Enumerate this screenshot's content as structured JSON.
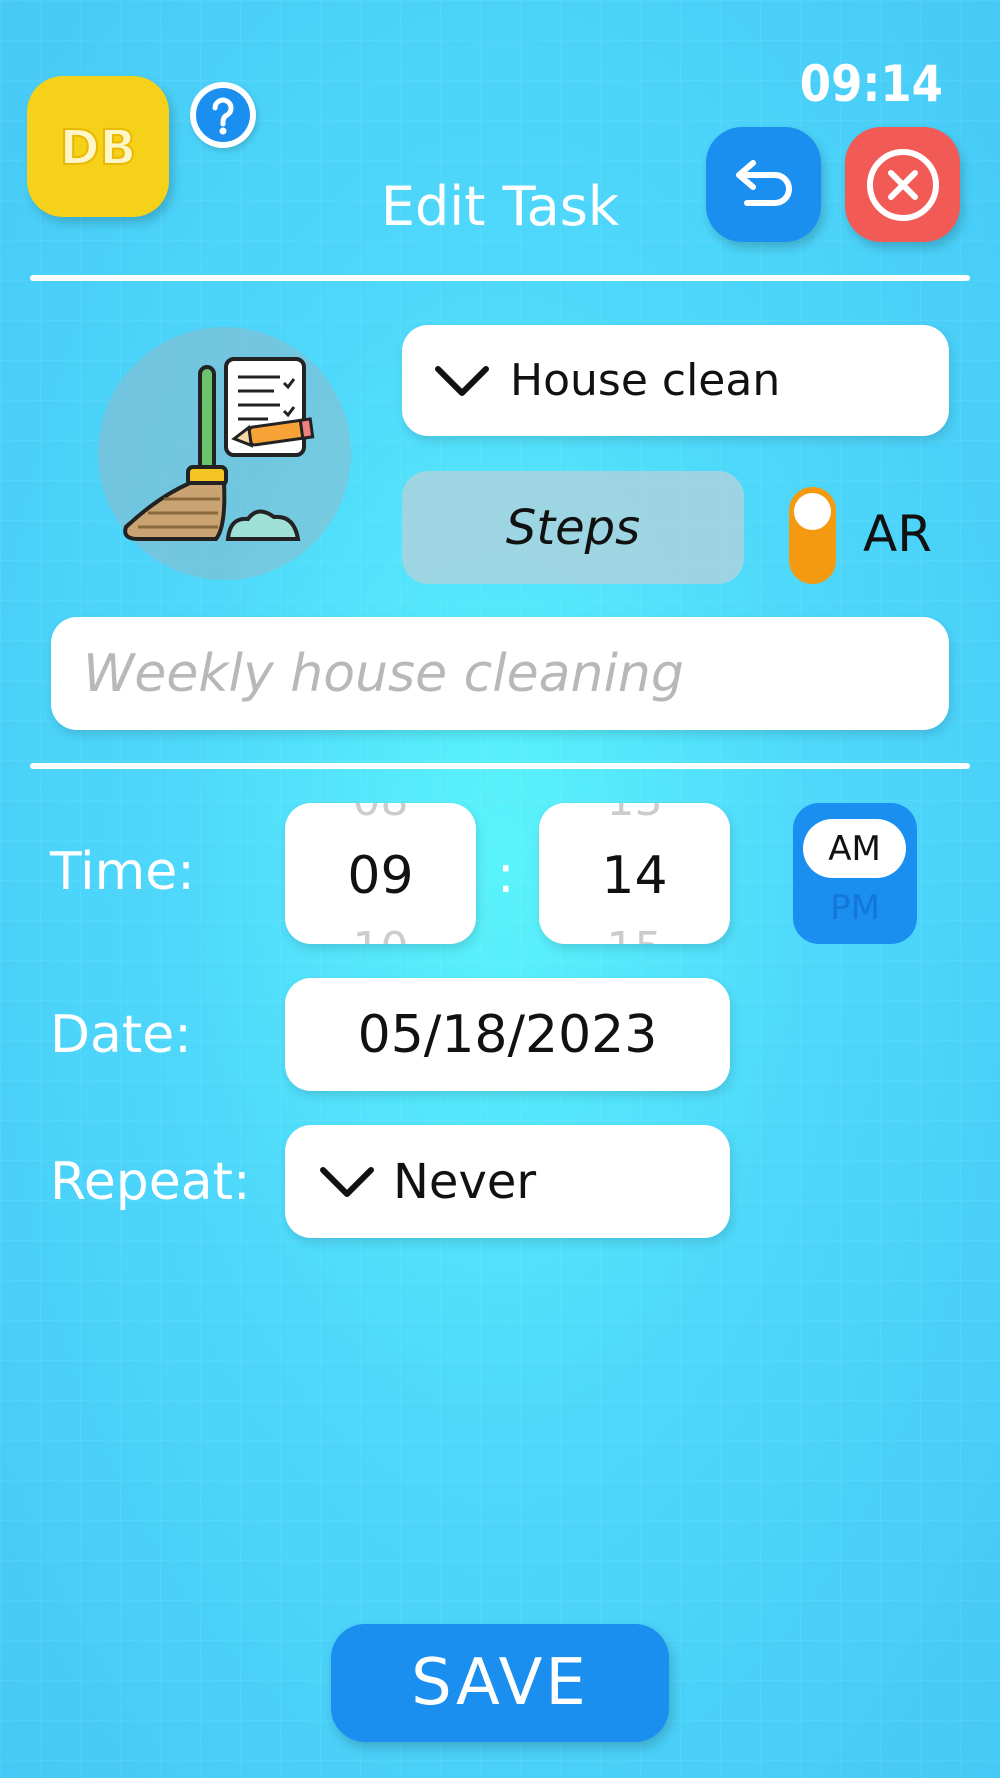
{
  "header": {
    "logo_text": "DB",
    "clock": "09:14",
    "title": "Edit Task",
    "help_icon": "question-mark-icon",
    "back_icon": "undo-arrow-icon",
    "close_icon": "close-circle-icon"
  },
  "task": {
    "illustration": "broom-checklist-icon",
    "category": "House clean",
    "steps_label": "Steps",
    "ar_toggle": {
      "label": "AR",
      "on": true
    },
    "description_placeholder": "Weekly house cleaning"
  },
  "schedule": {
    "time_label": "Time:",
    "hour": {
      "prev": "08",
      "value": "09",
      "next": "10"
    },
    "separator": ":",
    "minute": {
      "prev": "13",
      "value": "14",
      "next": "15"
    },
    "ampm": {
      "selected": "AM",
      "other": "PM"
    },
    "date_label": "Date:",
    "date": "05/18/2023",
    "repeat_label": "Repeat:",
    "repeat": "Never"
  },
  "actions": {
    "save_label": "SAVE"
  },
  "colors": {
    "accent_blue": "#1a8ff0",
    "close_red": "#f25a55",
    "logo_yellow": "#f6d11a",
    "toggle_orange": "#f39a10"
  }
}
